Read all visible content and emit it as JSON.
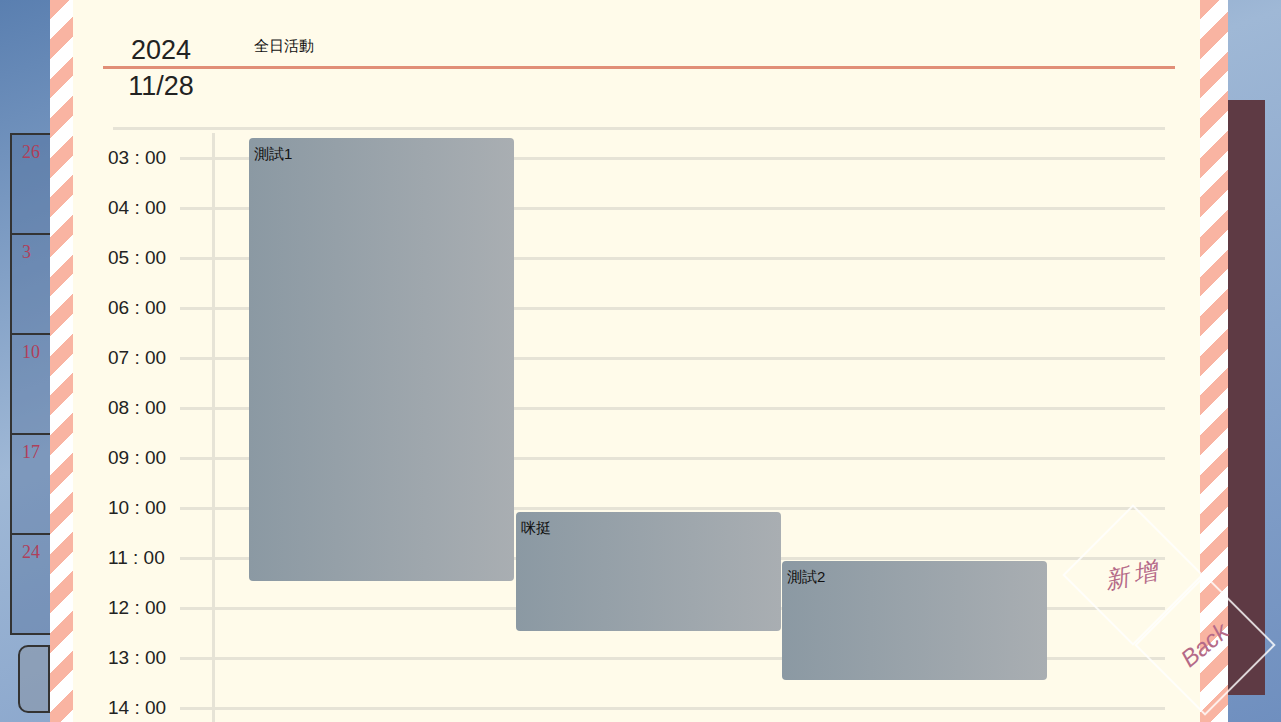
{
  "header": {
    "year": "2024",
    "date": "11/28"
  },
  "all_day": {
    "label": "全日活動"
  },
  "hours": [
    "03 : 00",
    "04 : 00",
    "05 : 00",
    "06 : 00",
    "07 : 00",
    "08 : 00",
    "09 : 00",
    "10 : 00",
    "11 : 00",
    "12 : 00",
    "13 : 00",
    "14 : 00"
  ],
  "events": [
    {
      "title": "測試1",
      "start": 2.6,
      "end": 11.46,
      "column": 0
    },
    {
      "title": "咪挺",
      "start": 10.08,
      "end": 12.46,
      "column": 1
    },
    {
      "title": "測試2",
      "start": 11.06,
      "end": 13.44,
      "column": 2
    }
  ],
  "calendar_days": [
    "26",
    "3",
    "10",
    "17",
    "24"
  ],
  "buttons": [
    {
      "label": "新增",
      "kind": "add"
    },
    {
      "label": "Back",
      "kind": "back"
    }
  ]
}
